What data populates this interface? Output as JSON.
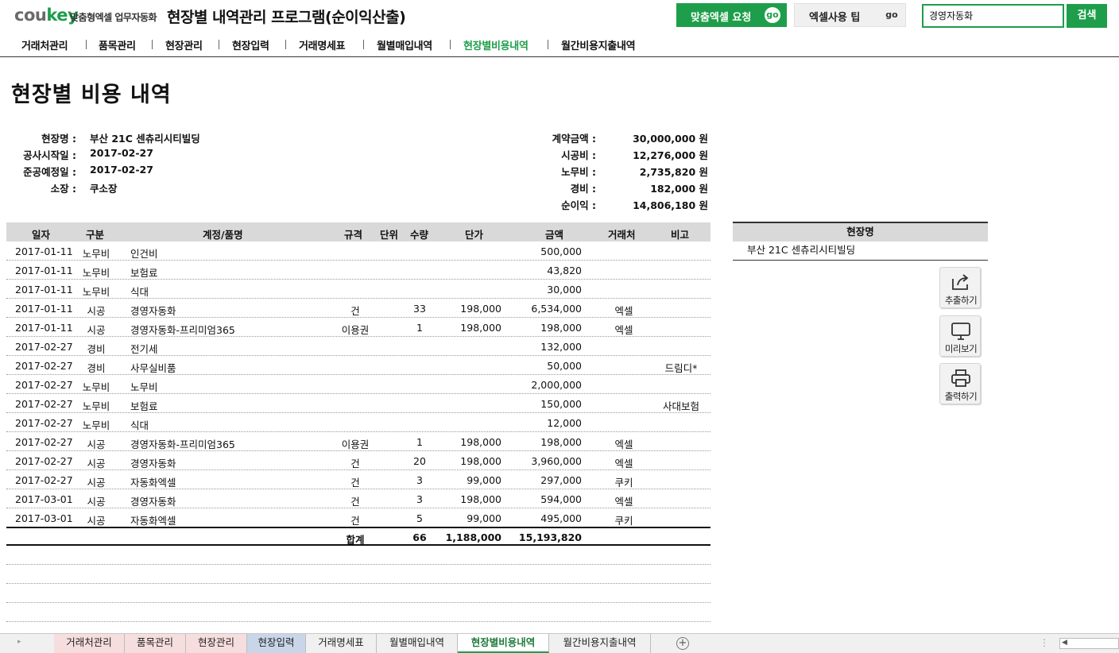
{
  "header": {
    "logo_a": "cou",
    "logo_b": "key",
    "logo_sub": "맞춤형엑셀 업무자동화",
    "app_title": "현장별 내역관리 프로그램(순이익산출)",
    "request_label": "맞춤엑셀 요청",
    "tips_label": "엑셀사용 팁",
    "go": "go",
    "search_value": "경영자동화",
    "search_button": "검색"
  },
  "nav": [
    "거래처관리",
    "품목관리",
    "현장관리",
    "현장입력",
    "거래명세표",
    "월별매입내역",
    "현장별비용내역",
    "월간비용지출내역"
  ],
  "page_title": "현장별 비용 내역",
  "info": [
    {
      "label": "현장명 :",
      "value": "부산 21C 센츄리시티빌딩"
    },
    {
      "label": "공사시작일 :",
      "value": "2017-02-27"
    },
    {
      "label": "준공예정일 :",
      "value": "2017-02-27"
    },
    {
      "label": "소장 :",
      "value": "쿠소장"
    }
  ],
  "finance": [
    {
      "label": "계약금액 :",
      "value": "30,000,000 원"
    },
    {
      "label": "시공비 :",
      "value": "12,276,000 원"
    },
    {
      "label": "노무비 :",
      "value": "2,735,820 원"
    },
    {
      "label": "경비 :",
      "value": "182,000 원"
    },
    {
      "label": "순이익 :",
      "value": "14,806,180 원"
    }
  ],
  "table": {
    "headers": [
      "일자",
      "구분",
      "계정/품명",
      "규격",
      "단위",
      "수량",
      "단가",
      "금액",
      "거래처",
      "비고"
    ],
    "rows": [
      {
        "date": "2017-01-11",
        "type": "노무비",
        "item": "인건비",
        "spec": "",
        "qty": "",
        "price": "",
        "amount": "500,000",
        "vendor": "",
        "note": ""
      },
      {
        "date": "2017-01-11",
        "type": "노무비",
        "item": "보험료",
        "spec": "",
        "qty": "",
        "price": "",
        "amount": "43,820",
        "vendor": "",
        "note": ""
      },
      {
        "date": "2017-01-11",
        "type": "노무비",
        "item": "식대",
        "spec": "",
        "qty": "",
        "price": "",
        "amount": "30,000",
        "vendor": "",
        "note": ""
      },
      {
        "date": "2017-01-11",
        "type": "시공",
        "item": "경영자동화",
        "spec": "건",
        "qty": "33",
        "price": "198,000",
        "amount": "6,534,000",
        "vendor": "엑셀",
        "note": ""
      },
      {
        "date": "2017-01-11",
        "type": "시공",
        "item": "경영자동화-프리미엄365",
        "spec": "이용권",
        "qty": "1",
        "price": "198,000",
        "amount": "198,000",
        "vendor": "엑셀",
        "note": ""
      },
      {
        "date": "2017-02-27",
        "type": "경비",
        "item": "전기세",
        "spec": "",
        "qty": "",
        "price": "",
        "amount": "132,000",
        "vendor": "",
        "note": ""
      },
      {
        "date": "2017-02-27",
        "type": "경비",
        "item": "사무실비품",
        "spec": "",
        "qty": "",
        "price": "",
        "amount": "50,000",
        "vendor": "",
        "note": "드림디*"
      },
      {
        "date": "2017-02-27",
        "type": "노무비",
        "item": "노무비",
        "spec": "",
        "qty": "",
        "price": "",
        "amount": "2,000,000",
        "vendor": "",
        "note": ""
      },
      {
        "date": "2017-02-27",
        "type": "노무비",
        "item": "보험료",
        "spec": "",
        "qty": "",
        "price": "",
        "amount": "150,000",
        "vendor": "",
        "note": "사대보험"
      },
      {
        "date": "2017-02-27",
        "type": "노무비",
        "item": "식대",
        "spec": "",
        "qty": "",
        "price": "",
        "amount": "12,000",
        "vendor": "",
        "note": ""
      },
      {
        "date": "2017-02-27",
        "type": "시공",
        "item": "경영자동화-프리미엄365",
        "spec": "이용권",
        "qty": "1",
        "price": "198,000",
        "amount": "198,000",
        "vendor": "엑셀",
        "note": ""
      },
      {
        "date": "2017-02-27",
        "type": "시공",
        "item": "경영자동화",
        "spec": "건",
        "qty": "20",
        "price": "198,000",
        "amount": "3,960,000",
        "vendor": "엑셀",
        "note": ""
      },
      {
        "date": "2017-02-27",
        "type": "시공",
        "item": "자동화엑셀",
        "spec": "건",
        "qty": "3",
        "price": "99,000",
        "amount": "297,000",
        "vendor": "쿠키",
        "note": ""
      },
      {
        "date": "2017-03-01",
        "type": "시공",
        "item": "경영자동화",
        "spec": "건",
        "qty": "3",
        "price": "198,000",
        "amount": "594,000",
        "vendor": "엑셀",
        "note": ""
      },
      {
        "date": "2017-03-01",
        "type": "시공",
        "item": "자동화엑셀",
        "spec": "건",
        "qty": "5",
        "price": "99,000",
        "amount": "495,000",
        "vendor": "쿠키",
        "note": ""
      }
    ],
    "total": {
      "label": "합계",
      "qty": "66",
      "price": "1,188,000",
      "amount": "15,193,820"
    }
  },
  "side_panel": {
    "header": "현장명",
    "value": "부산 21C 센츄리시티빌딩",
    "buttons": [
      {
        "label": "추출하기",
        "icon": "export-icon"
      },
      {
        "label": "미리보기",
        "icon": "monitor-icon"
      },
      {
        "label": "출력하기",
        "icon": "printer-icon"
      }
    ]
  },
  "sheet_tabs": [
    {
      "label": "거래처관리",
      "color": "#f6dede"
    },
    {
      "label": "품목관리",
      "color": "#f6dede"
    },
    {
      "label": "현장관리",
      "color": "#f6dede"
    },
    {
      "label": "현장입력",
      "color": "#c9d6ea"
    },
    {
      "label": "거래명세표",
      "color": "#f0f0f0"
    },
    {
      "label": "월별매입내역",
      "color": "#f0f0f0"
    },
    {
      "label": "현장별비용내역",
      "color": "#ffffff"
    },
    {
      "label": "월간비용지출내역",
      "color": "#f0f0f0"
    }
  ],
  "colors": {
    "accent": "#1e9e4a",
    "header_bg": "#d9d9d9"
  }
}
